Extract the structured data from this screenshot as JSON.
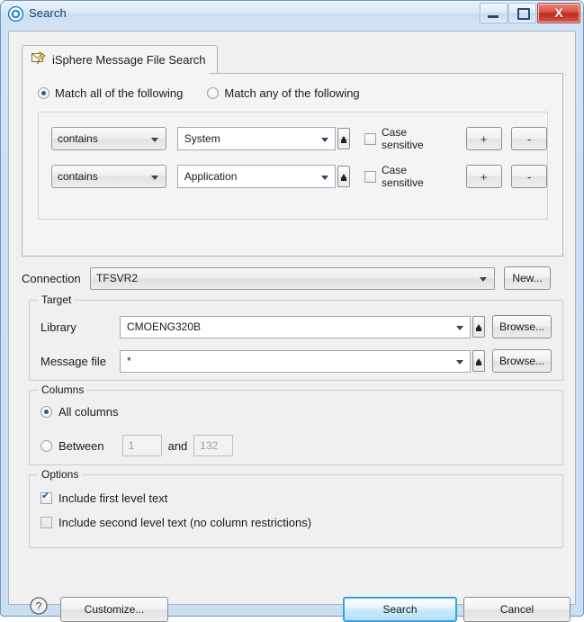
{
  "window": {
    "title": "Search",
    "icon": "isphere-logo-icon",
    "controls": {
      "minimize": "minimize-icon",
      "maximize": "maximize-icon",
      "close": "X"
    }
  },
  "tab": {
    "label": "iSphere Message File Search",
    "icon": "message-file-search-icon"
  },
  "match_mode": {
    "all_label": "Match all of the following",
    "any_label": "Match any of the following",
    "selected": "all"
  },
  "criteria": [
    {
      "operator": "contains",
      "value": "System",
      "case_sensitive_label": "Case sensitive",
      "case_sensitive_checked": false,
      "add_label": "+",
      "remove_label": "-"
    },
    {
      "operator": "contains",
      "value": "Application",
      "case_sensitive_label": "Case sensitive",
      "case_sensitive_checked": false,
      "add_label": "+",
      "remove_label": "-"
    }
  ],
  "connection": {
    "label": "Connection",
    "value": "TFSVR2",
    "new_button": "New..."
  },
  "target": {
    "legend": "Target",
    "library_label": "Library",
    "library_value": "CMOENG320B",
    "library_browse": "Browse...",
    "message_file_label": "Message file",
    "message_file_value": "*",
    "message_file_browse": "Browse..."
  },
  "columns": {
    "legend": "Columns",
    "all_label": "All columns",
    "between_label": "Between",
    "and_label": "and",
    "from_value": "1",
    "to_value": "132",
    "selected": "all"
  },
  "options": {
    "legend": "Options",
    "first_level_label": "Include first level text",
    "first_level_checked": true,
    "second_level_label": "Include second level text (no column restrictions)",
    "second_level_checked": false
  },
  "footer": {
    "help_icon": "help-icon",
    "customize_label": "Customize...",
    "search_label": "Search",
    "cancel_label": "Cancel"
  },
  "colors": {
    "accent": "#35a4e0",
    "title_text": "#123a5e",
    "close_red": "#bb2b1c",
    "dialog_bg": "#f0f0f0"
  }
}
